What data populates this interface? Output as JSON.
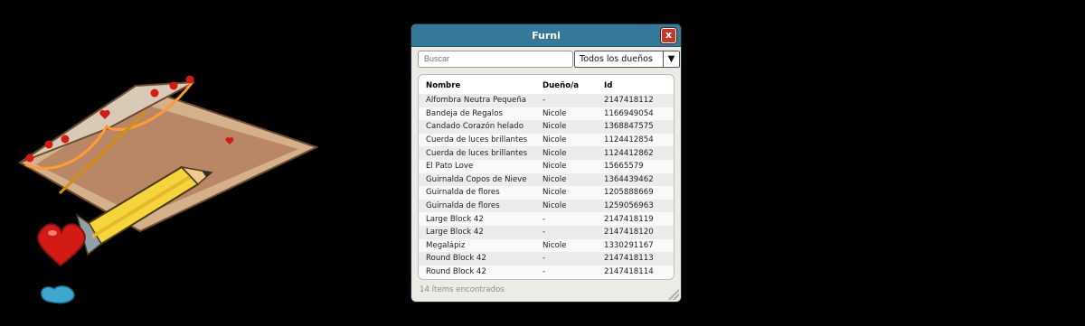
{
  "window": {
    "title": "Furni",
    "close_label": "x"
  },
  "search": {
    "placeholder": "Buscar"
  },
  "filter": {
    "selected": "Todos los dueños",
    "arrow": "▼"
  },
  "table": {
    "columns": [
      "Nombre",
      "Dueño/a",
      "Id"
    ],
    "rows": [
      [
        "Alfombra Neutra Pequeña",
        "-",
        "2147418112"
      ],
      [
        "Bandeja de Regalos",
        "Nicole",
        "1166949054"
      ],
      [
        "Candado Corazón helado",
        "Nicole",
        "1368847575"
      ],
      [
        "Cuerda de luces brillantes",
        "Nicole",
        "1124412854"
      ],
      [
        "Cuerda de luces brillantes",
        "Nicole",
        "1124412862"
      ],
      [
        "El Pato Love",
        "Nicole",
        "15665579"
      ],
      [
        "Guirnalda Copos de Nieve",
        "Nicole",
        "1364439462"
      ],
      [
        "Guirnalda de flores",
        "Nicole",
        "1205888669"
      ],
      [
        "Guirnalda de flores",
        "Nicole",
        "1259056963"
      ],
      [
        "Large Block 42",
        "-",
        "2147418119"
      ],
      [
        "Large Block 42",
        "-",
        "2147418120"
      ],
      [
        "Megalápiz",
        "Nicole",
        "1330291167"
      ],
      [
        "Round Block 42",
        "-",
        "2147418113"
      ],
      [
        "Round Block 42",
        "-",
        "2147418114"
      ]
    ]
  },
  "footer": {
    "count_text": "14 ítems encontrados"
  },
  "colors": {
    "titlebar": "#367897",
    "close": "#c1392b",
    "window_bg": "#ecebe6"
  },
  "icons": {
    "close": "close-icon",
    "dropdown": "chevron-down-icon",
    "resize": "resize-grip-icon"
  }
}
